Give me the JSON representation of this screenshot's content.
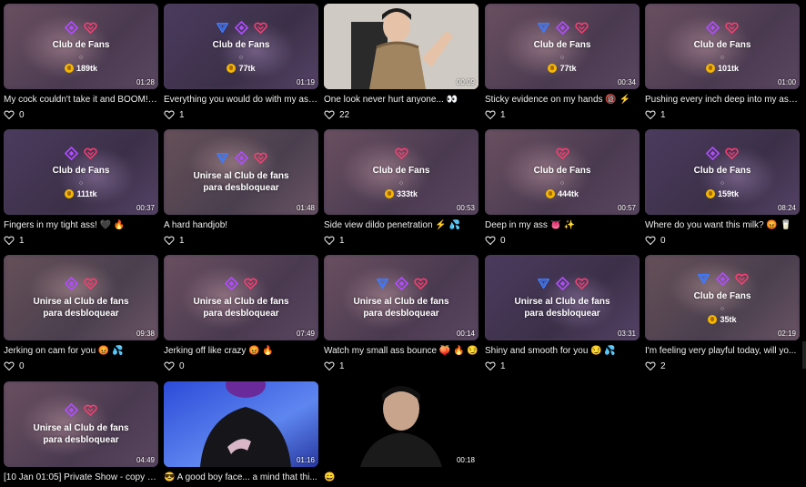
{
  "colors": {
    "accent_pink": "#ff3d71",
    "accent_purple": "#b04cff",
    "accent_blue": "#3f7bff",
    "coin": "#f5b700"
  },
  "videos": [
    {
      "title": "My cock couldn't take it and BOOM! 💥",
      "likes": "0",
      "duration": "01:28",
      "locked": true,
      "lock_text": "Club de Fans",
      "dot": "○",
      "price": "189tk",
      "icons": [
        "diamond-icon",
        "heart-badge-icon"
      ]
    },
    {
      "title": "Everything you would do with my ass...",
      "likes": "1",
      "duration": "01:19",
      "locked": true,
      "lock_text": "Club de Fans",
      "dot": "○",
      "price": "77tk",
      "icons": [
        "triangle-icon",
        "diamond-icon",
        "heart-badge-icon"
      ]
    },
    {
      "title": "One look never hurt anyone... 👀",
      "likes": "22",
      "duration": "00:09",
      "locked": false
    },
    {
      "title": "Sticky evidence on my hands 🔞 ⚡",
      "likes": "1",
      "duration": "00:34",
      "locked": true,
      "lock_text": "Club de Fans",
      "dot": "○",
      "price": "77tk",
      "icons": [
        "triangle-icon",
        "diamond-icon",
        "heart-badge-icon"
      ]
    },
    {
      "title": "Pushing every inch deep into my ass...",
      "likes": "1",
      "duration": "01:00",
      "locked": true,
      "lock_text": "Club de Fans",
      "dot": "○",
      "price": "101tk",
      "icons": [
        "diamond-icon",
        "heart-badge-icon"
      ]
    },
    {
      "title": "Fingers in my tight ass! 🖤 🔥",
      "likes": "1",
      "duration": "00:37",
      "locked": true,
      "lock_text": "Club de Fans",
      "dot": "○",
      "price": "111tk",
      "icons": [
        "diamond-icon",
        "heart-badge-icon"
      ]
    },
    {
      "title": "A hard handjob!",
      "likes": "1",
      "duration": "01:48",
      "locked": true,
      "lock_text": "Unirse al Club de fans para desbloquear",
      "icons": [
        "triangle-icon",
        "diamond-icon",
        "heart-badge-icon"
      ]
    },
    {
      "title": "Side view dildo penetration ⚡ 💦",
      "likes": "1",
      "duration": "00:53",
      "locked": true,
      "lock_text": "Club de Fans",
      "dot": "○",
      "price": "333tk",
      "icons": [
        "heart-badge-icon"
      ]
    },
    {
      "title": "Deep in my ass 👅 ✨",
      "likes": "0",
      "duration": "00:57",
      "locked": true,
      "lock_text": "Club de Fans",
      "dot": "○",
      "price": "444tk",
      "icons": [
        "heart-badge-icon"
      ]
    },
    {
      "title": "Where do you want this milk? 😡 🥛",
      "likes": "0",
      "duration": "08:24",
      "locked": true,
      "lock_text": "Club de Fans",
      "dot": "○",
      "price": "159tk",
      "icons": [
        "diamond-icon",
        "heart-badge-icon"
      ]
    },
    {
      "title": "Jerking on cam for you 😡 💦",
      "likes": "0",
      "duration": "09:38",
      "locked": true,
      "lock_text": "Unirse al Club de fans para desbloquear",
      "icons": [
        "diamond-icon",
        "heart-badge-icon"
      ]
    },
    {
      "title": "Jerking off like crazy 😡 🔥",
      "likes": "0",
      "duration": "07:49",
      "locked": true,
      "lock_text": "Unirse al Club de fans para desbloquear",
      "icons": [
        "diamond-icon",
        "heart-badge-icon"
      ]
    },
    {
      "title": "Watch my small ass bounce 🍑 🔥 😏",
      "likes": "1",
      "duration": "00:14",
      "locked": true,
      "lock_text": "Unirse al Club de fans para desbloquear",
      "icons": [
        "triangle-icon",
        "diamond-icon",
        "heart-badge-icon"
      ]
    },
    {
      "title": "Shiny and smooth for you 😏 💦",
      "likes": "1",
      "duration": "03:31",
      "locked": true,
      "lock_text": "Unirse al Club de fans para desbloquear",
      "icons": [
        "triangle-icon",
        "diamond-icon",
        "heart-badge-icon"
      ]
    },
    {
      "title": "I'm feeling very playful today, will yo...",
      "likes": "2",
      "duration": "02:19",
      "locked": true,
      "lock_text": "Club de Fans",
      "dot": "○",
      "price": "35tk",
      "icons": [
        "triangle-icon",
        "diamond-icon",
        "heart-badge-icon"
      ]
    },
    {
      "title": "[10 Jan 01:05] Private Show - copy 1...",
      "likes": "",
      "duration": "04:49",
      "locked": true,
      "lock_text": "Unirse al Club de fans para desbloquear",
      "icons": [
        "diamond-icon",
        "heart-badge-icon"
      ]
    },
    {
      "title": "😎 A good boy face... a mind that thi...",
      "likes": "",
      "duration": "01:16",
      "locked": false
    },
    {
      "title": "😄",
      "likes": "",
      "duration": "00:18",
      "locked": false
    }
  ]
}
